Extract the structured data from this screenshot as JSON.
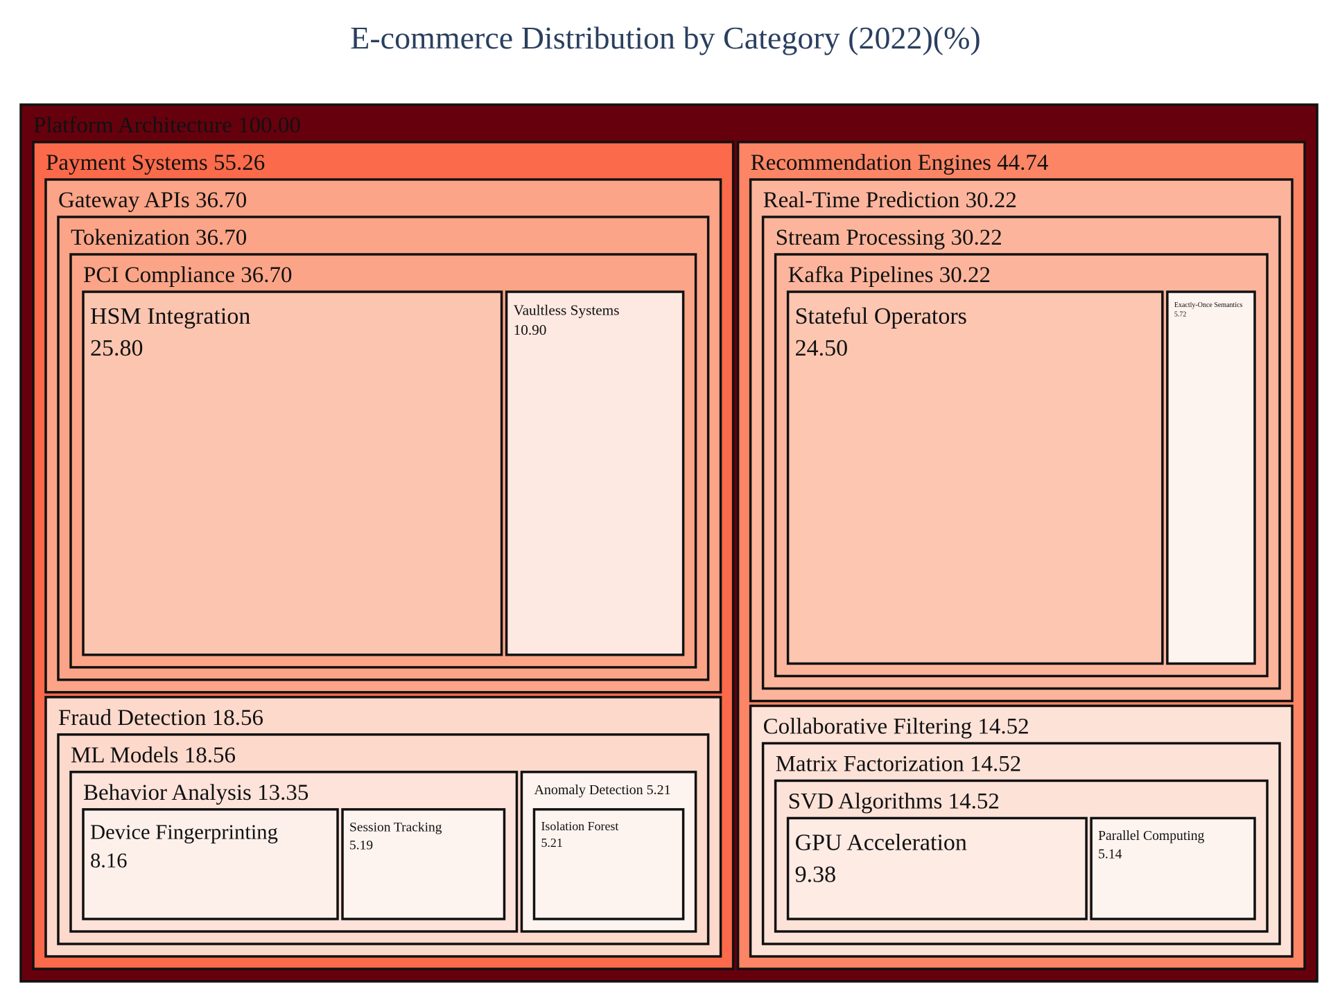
{
  "chart_data": {
    "type": "treemap",
    "title": "E-commerce Distribution by Category (2022)(%)",
    "colorscale": [
      "#fff5f0",
      "#fee0d2",
      "#fcbba1",
      "#fc9272",
      "#fb6a4a",
      "#ef3b2c",
      "#cb181d",
      "#a50f15",
      "#67000d"
    ],
    "border_color": "#111111",
    "root": {
      "name": "Platform Architecture",
      "value": 100.0,
      "color": "#67000d",
      "text": "#111111",
      "children": [
        {
          "name": "Payment Systems",
          "value": 55.26,
          "color": "#fb6a4a",
          "children": [
            {
              "name": "Gateway APIs",
              "value": 36.7,
              "color": "#fca487",
              "children": [
                {
                  "name": "Tokenization",
                  "value": 36.7,
                  "color": "#fca487",
                  "children": [
                    {
                      "name": "PCI Compliance",
                      "value": 36.7,
                      "color": "#fca487",
                      "children": [
                        {
                          "name": "HSM Integration",
                          "value": 25.8,
                          "color": "#fcc5b0"
                        },
                        {
                          "name": "Vaultless Systems",
                          "value": 10.9,
                          "color": "#fde9e2"
                        }
                      ]
                    }
                  ]
                }
              ]
            },
            {
              "name": "Fraud Detection",
              "value": 18.56,
              "color": "#fdd9cb",
              "children": [
                {
                  "name": "ML Models",
                  "value": 18.56,
                  "color": "#fdd9cb",
                  "children": [
                    {
                      "name": "Behavior Analysis",
                      "value": 13.35,
                      "color": "#fde3da",
                      "children": [
                        {
                          "name": "Device Fingerprinting",
                          "value": 8.16,
                          "color": "#fdf0eb"
                        },
                        {
                          "name": "Session Tracking",
                          "value": 5.19,
                          "color": "#fdf3ef"
                        }
                      ]
                    },
                    {
                      "name": "Anomaly Detection",
                      "value": 5.21,
                      "color": "#fdf3ef",
                      "children": [
                        {
                          "name": "Isolation Forest",
                          "value": 5.21,
                          "color": "#fdf3ef"
                        }
                      ]
                    }
                  ]
                }
              ]
            }
          ]
        },
        {
          "name": "Recommendation Engines",
          "value": 44.74,
          "color": "#fc8565",
          "children": [
            {
              "name": "Real-Time Prediction",
              "value": 30.22,
              "color": "#fcb59c",
              "children": [
                {
                  "name": "Stream Processing",
                  "value": 30.22,
                  "color": "#fcb59c",
                  "children": [
                    {
                      "name": "Kafka Pipelines",
                      "value": 30.22,
                      "color": "#fcb59c",
                      "children": [
                        {
                          "name": "Stateful Operators",
                          "value": 24.5,
                          "color": "#fcc6b1"
                        },
                        {
                          "name": "Exactly-Once Semantics",
                          "value": 5.72,
                          "color": "#fdf3ef"
                        }
                      ]
                    }
                  ]
                }
              ]
            },
            {
              "name": "Collaborative Filtering",
              "value": 14.52,
              "color": "#fde2d8",
              "children": [
                {
                  "name": "Matrix Factorization",
                  "value": 14.52,
                  "color": "#fde2d8",
                  "children": [
                    {
                      "name": "SVD Algorithms",
                      "value": 14.52,
                      "color": "#fde2d8",
                      "children": [
                        {
                          "name": "GPU Acceleration",
                          "value": 9.38,
                          "color": "#fdebe4"
                        },
                        {
                          "name": "Parallel Computing",
                          "value": 5.14,
                          "color": "#fdf3ef"
                        }
                      ]
                    }
                  ]
                }
              ]
            }
          ]
        }
      ]
    }
  }
}
